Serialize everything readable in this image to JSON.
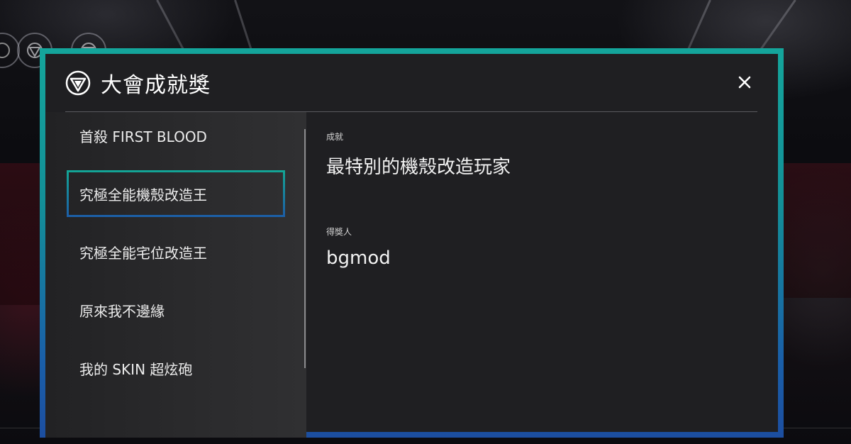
{
  "dialog": {
    "title": "大會成就獎",
    "logo_icon": "triangle-emblem-icon",
    "close_icon": "close-icon",
    "colors": {
      "frame_top": "#14a59b",
      "frame_bottom": "#1c4ea0",
      "panel_bg": "#1f1f22"
    }
  },
  "sidebar": {
    "items": [
      {
        "label": "首殺 FIRST BLOOD",
        "active": false
      },
      {
        "label": "究極全能機殼改造王",
        "active": true
      },
      {
        "label": "究極全能宅位改造王",
        "active": false
      },
      {
        "label": "原來我不邊緣",
        "active": false
      },
      {
        "label": "我的 SKIN 超炫砲",
        "active": false
      }
    ]
  },
  "detail": {
    "achievement_label": "成就",
    "achievement_value": "最特別的機殼改造玩家",
    "winner_label": "得獎人",
    "winner_value": "bgmod"
  }
}
